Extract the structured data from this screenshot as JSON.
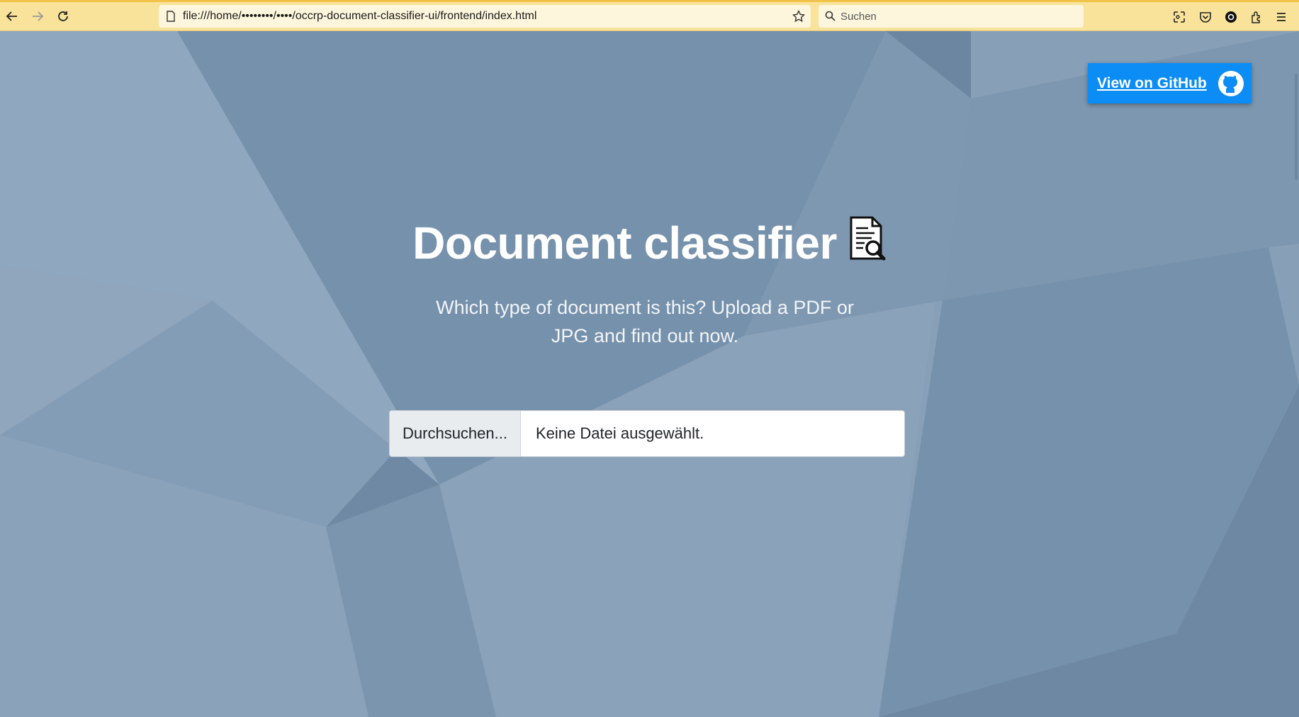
{
  "browser": {
    "url": "file:///home/••••••••/••••/occrp-document-classifier-ui/frontend/index.html",
    "search_placeholder": "Suchen",
    "icons": [
      "back-icon",
      "forward-icon",
      "reload-icon",
      "page-icon",
      "bookmark-star-icon",
      "search-icon",
      "screenshot-icon",
      "pocket-icon",
      "account-icon",
      "extensions-icon",
      "menu-icon"
    ]
  },
  "page": {
    "github_label": "View on GitHub",
    "title": "Document classifier",
    "subtitle": "Which type of document is this? Upload a PDF or JPG and find out now.",
    "file_input": {
      "browse_label": "Durchsuchen...",
      "filename": "Keine Datei ausgewählt."
    }
  },
  "colors": {
    "toolbar_bg": "#f9e39a",
    "page_bg": "#87a0b8",
    "github_button": "#0c8cf5"
  }
}
